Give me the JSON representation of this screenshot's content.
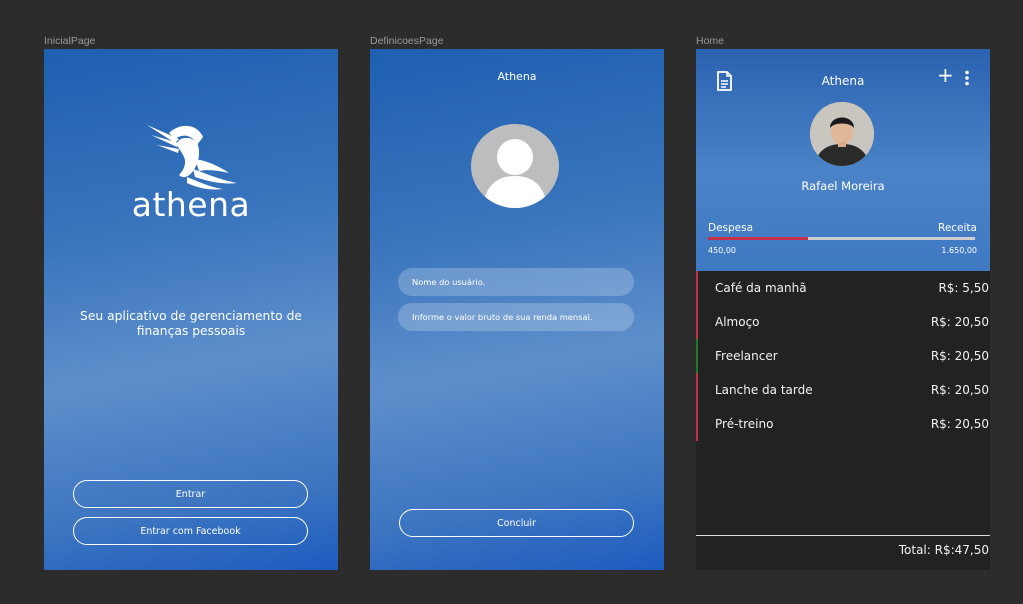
{
  "frames": {
    "inicial": {
      "label": "InicialPage"
    },
    "definicoes": {
      "label": "DefinicoesPage"
    },
    "home": {
      "label": "Home"
    }
  },
  "inicial": {
    "logo_text": "athena",
    "tagline_line1": "Seu aplicativo de gerenciamento de",
    "tagline_line2": "finanças pessoais",
    "enter_label": "Entrar",
    "facebook_label": "Entrar com Facebook"
  },
  "definicoes": {
    "title": "Athena",
    "username_placeholder": "Nome do usuário.",
    "income_placeholder": "Informe o valor bruto de sua renda mensal.",
    "conclude_label": "Concluir"
  },
  "home": {
    "title": "Athena",
    "user_name": "Rafael Moreira",
    "expense_label": "Despesa",
    "income_label": "Receita",
    "expense_value": "450,00",
    "income_value": "1.650,00",
    "expense_ratio": 0.375,
    "transactions": [
      {
        "name": "Café da manhã",
        "amount": "R$: 5,50",
        "type": "expense",
        "color": "#c6314a"
      },
      {
        "name": "Almoço",
        "amount": "R$: 20,50",
        "type": "expense",
        "color": "#c6314a"
      },
      {
        "name": "Freelancer",
        "amount": "R$: 20,50",
        "type": "income",
        "color": "#1f7a2e"
      },
      {
        "name": "Lanche da tarde",
        "amount": "R$: 20,50",
        "type": "expense",
        "color": "#c6314a"
      },
      {
        "name": "Pré-treino",
        "amount": "R$: 20,50",
        "type": "expense",
        "color": "#c6314a"
      }
    ],
    "total": "Total: R$:47,50"
  },
  "icons": {
    "helmet": "athena-helmet-icon",
    "user_placeholder": "user-placeholder-icon",
    "document": "document-icon",
    "plus": "plus-icon",
    "more": "more-vertical-icon"
  },
  "colors": {
    "gradient_top": "#1e5fb1",
    "gradient_mid": "#5e8fcb",
    "expense": "#c6314a",
    "income": "#1f7a2e",
    "dark_bg": "#222222"
  }
}
